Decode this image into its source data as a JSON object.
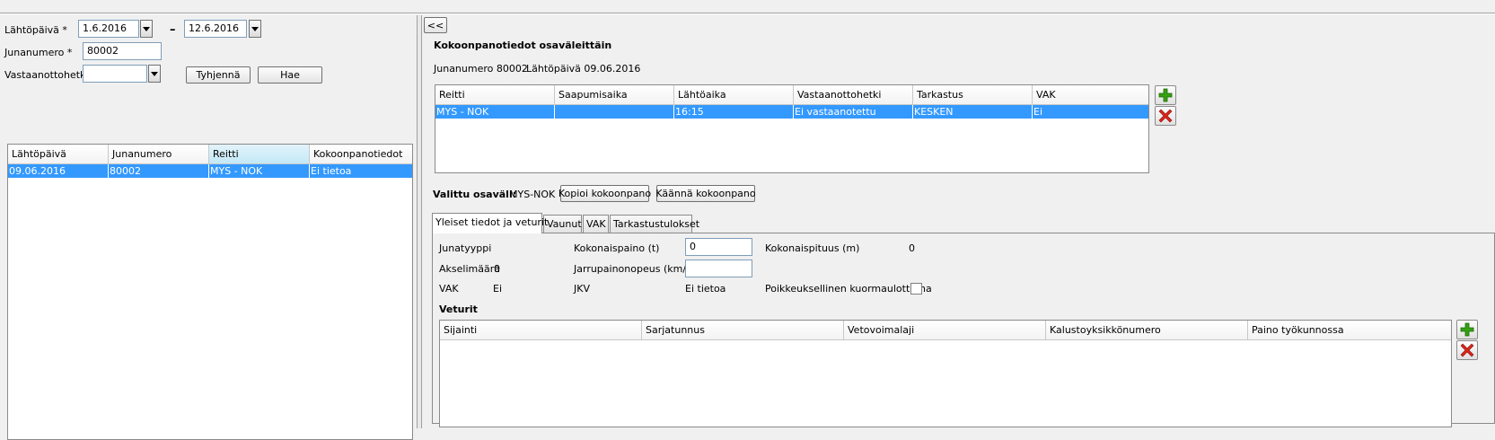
{
  "filters": {
    "lahtopaiva_label": "Lähtöpäivä *",
    "date_from": "1.6.2016",
    "date_sep": "–",
    "date_to": "12.6.2016",
    "junanumero_label": "Junanumero *",
    "junanumero_value": "80002",
    "vastaanottohetki_label": "Vastaanottohetki",
    "vastaanottohetki_value": "",
    "clear_button": "Tyhjennä",
    "search_button": "Hae"
  },
  "results_table": {
    "columns": [
      "Lähtöpäivä",
      "Junanumero",
      "Reitti",
      "Kokoonpanotiedot"
    ],
    "rows": [
      [
        "09.06.2016",
        "80002",
        "MYS - NOK",
        "Ei tietoa"
      ]
    ]
  },
  "right": {
    "collapse_button": "<<",
    "section_title": "Kokoonpanotiedot osaväleittäin",
    "train_label": "Junanumero 80002",
    "date_label": "Lähtöpäivä 09.06.2016",
    "segments_table": {
      "columns": [
        "Reitti",
        "Saapumisaika",
        "Lähtöaika",
        "Vastaanottohetki",
        "Tarkastus",
        "VAK"
      ],
      "rows": [
        [
          "MYS - NOK",
          "",
          "16:15",
          "Ei vastaanotettu",
          "KESKEN",
          "Ei"
        ]
      ]
    },
    "selected_label": "Valittu osaväli:",
    "selected_value": "MYS-NOK",
    "copy_button": "Kopioi kokoonpano",
    "reverse_button": "Käännä kokoonpano",
    "tabs": [
      "Yleiset tiedot ja veturit",
      "Vaunut",
      "VAK",
      "Tarkastustulokset"
    ],
    "general": {
      "junatyyppi_label": "Junatyyppi",
      "kokonaispaino_label": "Kokonaispaino (t)",
      "kokonaispaino_value": "0",
      "kokonaispituus_label": "Kokonaispituus (m)",
      "kokonaispituus_value": "0",
      "akselimaara_label": "Akselimäärä",
      "akselimaara_value": "0",
      "jarrupainonopeus_label": "Jarrupainonopeus (km/h)",
      "jarrupainonopeus_value": "",
      "vak_label": "VAK",
      "vak_value": "Ei",
      "jkv_label": "JKV",
      "jkv_value": "Ei tietoa",
      "poikkeuksellinen_label": "Poikkeuksellinen kuormaulottuma",
      "veturit_title": "Veturit"
    },
    "locomotives_table": {
      "columns": [
        "Sijainti",
        "Sarjatunnus",
        "Vetovoimalaji",
        "Kalustoyksikkönumero",
        "Paino työkunnossa"
      ]
    }
  },
  "colors": {
    "selection": "#3399ff",
    "add_icon": "#35a012",
    "remove_icon": "#d8261c"
  }
}
